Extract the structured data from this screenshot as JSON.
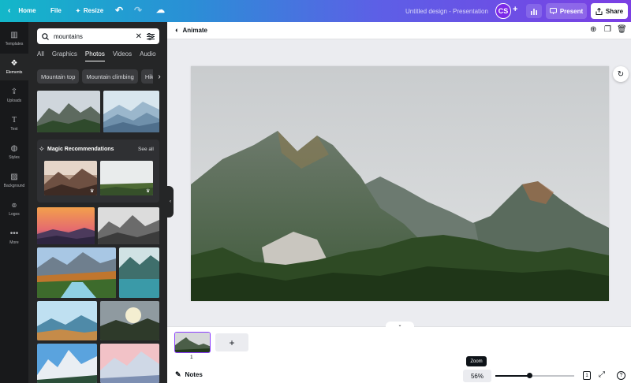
{
  "topbar": {
    "home": "Home",
    "file": "File",
    "resize": "Resize",
    "title": "Untitled design - Presentation",
    "avatar": "CS",
    "present": "Present",
    "share": "Share"
  },
  "rail": {
    "items": [
      {
        "label": "Templates"
      },
      {
        "label": "Elements"
      },
      {
        "label": "Uploads"
      },
      {
        "label": "Text"
      },
      {
        "label": "Styles"
      },
      {
        "label": "Background"
      },
      {
        "label": "Logos"
      },
      {
        "label": "More"
      }
    ]
  },
  "panel": {
    "search_value": "mountains",
    "tabs": [
      "All",
      "Graphics",
      "Photos",
      "Videos",
      "Audio"
    ],
    "active_tab": "Photos",
    "chips": [
      "Mountain top",
      "Mountain climbing",
      "Hiki"
    ],
    "magic_title": "Magic Recommendations",
    "magic_see_all": "See all"
  },
  "editor": {
    "animate": "Animate"
  },
  "bottom": {
    "page_number": "1",
    "notes": "Notes",
    "zoom_tooltip": "Zoom",
    "zoom_value": "56%",
    "zoom_level": 0.43,
    "pages_count": "1"
  },
  "colors": {
    "accent": "#8b3dff",
    "panel_bg": "#252627",
    "rail_bg": "#18191b"
  }
}
